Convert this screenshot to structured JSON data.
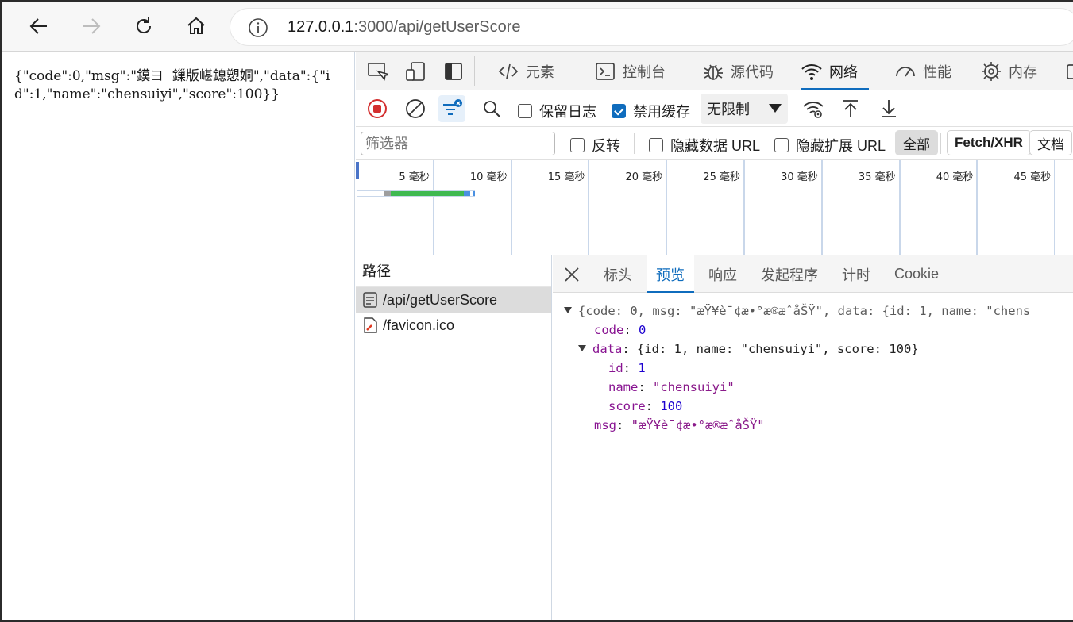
{
  "browser": {
    "url_host": "127.0.0.1",
    "url_path": ":3000/api/getUserScore"
  },
  "page": {
    "raw_text": "{\"code\":0,\"msg\":\"鏌ヨ  鏁版嵁鎴愬姛\",\"data\":{\"id\":1,\"name\":\"chensuiyi\",\"score\":100}}"
  },
  "devtools": {
    "tabs": [
      {
        "label": "元素",
        "icon": "code-icon"
      },
      {
        "label": "控制台",
        "icon": "console-icon"
      },
      {
        "label": "源代码",
        "icon": "bug-icon"
      },
      {
        "label": "网络",
        "icon": "wifi-icon"
      },
      {
        "label": "性能",
        "icon": "gauge-icon"
      },
      {
        "label": "内存",
        "icon": "chip-icon"
      }
    ],
    "network_toolbar": {
      "preserve_log": "保留日志",
      "preserve_log_checked": false,
      "disable_cache": "禁用缓存",
      "disable_cache_checked": true,
      "throttle": "无限制"
    },
    "filter": {
      "placeholder": "筛选器",
      "invert": "反转",
      "hide_data_urls": "隐藏数据 URL",
      "hide_ext_urls": "隐藏扩展 URL",
      "types": [
        "全部",
        "Fetch/XHR",
        "文档"
      ]
    },
    "timeline": {
      "ticks": [
        "5 毫秒",
        "10 毫秒",
        "15 毫秒",
        "20 毫秒",
        "25 毫秒",
        "30 毫秒",
        "35 毫秒",
        "40 毫秒",
        "45 毫秒"
      ]
    },
    "requests": {
      "header": "路径",
      "items": [
        {
          "name": "/api/getUserScore",
          "icon": "document-icon",
          "selected": true
        },
        {
          "name": "/favicon.ico",
          "icon": "image-file-icon",
          "selected": false
        }
      ]
    },
    "detail_tabs": [
      "标头",
      "预览",
      "响应",
      "发起程序",
      "计时",
      "Cookie"
    ],
    "detail_active": "预览",
    "preview": {
      "summary": "{code: 0, msg: \"æŸ¥è¯¢æ•°æ®æˆåŠŸ\", data: {id: 1, name: \"chens",
      "code_key": "code",
      "code_val": "0",
      "data_key": "data",
      "data_summary": "{id: 1, name: \"chensuiyi\", score: 100}",
      "id_key": "id",
      "id_val": "1",
      "name_key": "name",
      "name_val": "\"chensuiyi\"",
      "score_key": "score",
      "score_val": "100",
      "msg_key": "msg",
      "msg_val": "\"æŸ¥è¯¢æ•°æ®æˆåŠŸ\""
    }
  }
}
